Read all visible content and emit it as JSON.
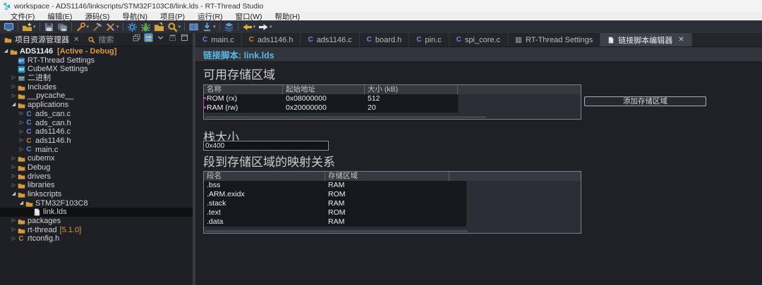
{
  "window": {
    "title": "workspace - ADS1146/linkscripts/STM32F103C8/link.lds - RT-Thread Studio",
    "menu_items": [
      "文件(F)",
      "编辑(E)",
      "源码(S)",
      "导航(N)",
      "项目(P)",
      "运行(R)",
      "窗口(W)",
      "帮助(H)"
    ]
  },
  "toolbar": {
    "groups": [
      [
        {
          "name": "monitor"
        }
      ],
      [
        {
          "name": "new-wizard",
          "dropdown": true
        }
      ],
      [
        {
          "name": "save"
        },
        {
          "name": "save-all"
        }
      ],
      [
        {
          "name": "build-wrench",
          "dropdown": true
        },
        {
          "name": "pickaxe"
        },
        {
          "name": "tools",
          "dropdown": true
        }
      ],
      [
        {
          "name": "gear"
        },
        {
          "name": "debug-bug"
        },
        {
          "name": "open-folder"
        },
        {
          "name": "search",
          "dropdown": true
        }
      ],
      [
        {
          "name": "book"
        },
        {
          "name": "download",
          "dropdown": true
        }
      ],
      [
        {
          "name": "layers"
        }
      ],
      [
        {
          "name": "back-arrow",
          "dropdown": true
        },
        {
          "name": "forward-arrow",
          "dropdown": true
        }
      ]
    ]
  },
  "explorer": {
    "tab_label": "项目资源管理器",
    "search_tab_label": "搜索",
    "tools": [
      "collapse-all",
      "link-editor",
      "chevron-down",
      "minimize",
      "maximize"
    ],
    "tree": [
      {
        "label": "ADS1146",
        "suffix": "[Active - Debug]",
        "icon": "folder",
        "depth": 0,
        "state": "expanded",
        "bold": true
      },
      {
        "label": "RT-Thread Settings",
        "icon": "rt-badge",
        "depth": 1,
        "state": "leaf"
      },
      {
        "label": "CubeMX Settings",
        "icon": "mx-badge",
        "depth": 1,
        "state": "leaf"
      },
      {
        "label": "二进制",
        "icon": "binary",
        "depth": 1,
        "state": "collapsed"
      },
      {
        "label": "Includes",
        "icon": "folder",
        "depth": 1,
        "state": "collapsed"
      },
      {
        "label": "__pycache__",
        "icon": "folder",
        "depth": 1,
        "state": "collapsed"
      },
      {
        "label": "applications",
        "icon": "folder",
        "depth": 1,
        "state": "expanded"
      },
      {
        "label": "ads_can.c",
        "icon": "c-blue",
        "depth": 2,
        "state": "collapsed"
      },
      {
        "label": "ads_can.h",
        "icon": "c-blue",
        "depth": 2,
        "state": "collapsed"
      },
      {
        "label": "ads1146.c",
        "icon": "c-blue",
        "depth": 2,
        "state": "collapsed"
      },
      {
        "label": "ads1146.h",
        "icon": "c-orange",
        "depth": 2,
        "state": "collapsed"
      },
      {
        "label": "main.c",
        "icon": "c-blue",
        "depth": 2,
        "state": "collapsed"
      },
      {
        "label": "cubemx",
        "icon": "folder",
        "depth": 1,
        "state": "collapsed"
      },
      {
        "label": "Debug",
        "icon": "folder",
        "depth": 1,
        "state": "collapsed"
      },
      {
        "label": "drivers",
        "icon": "folder",
        "depth": 1,
        "state": "collapsed"
      },
      {
        "label": "libraries",
        "icon": "folder",
        "depth": 1,
        "state": "collapsed"
      },
      {
        "label": "linkscripts",
        "icon": "folder",
        "depth": 1,
        "state": "expanded"
      },
      {
        "label": "STM32F103C8",
        "icon": "folder",
        "depth": 2,
        "state": "expanded"
      },
      {
        "label": "link.lds",
        "icon": "lds-file",
        "depth": 3,
        "state": "leaf",
        "selected": true
      },
      {
        "label": "packages",
        "icon": "folder",
        "depth": 1,
        "state": "collapsed"
      },
      {
        "label": "rt-thread",
        "suffix_plain": "[5.1.0]",
        "icon": "folder",
        "depth": 1,
        "state": "collapsed"
      },
      {
        "label": "rtconfig.h",
        "icon": "c-orange",
        "depth": 1,
        "state": "collapsed"
      }
    ]
  },
  "editor": {
    "tabs": [
      {
        "label": "main.c",
        "icon": "c-blue"
      },
      {
        "label": "ads1146.h",
        "icon": "c-orange"
      },
      {
        "label": "ads1146.c",
        "icon": "c-blue"
      },
      {
        "label": "board.h",
        "icon": "c-blue"
      },
      {
        "label": "pin.c",
        "icon": "c-blue"
      },
      {
        "label": "spi_core.c",
        "icon": "c-blue"
      },
      {
        "label": "RT-Thread Settings",
        "icon": "grid"
      },
      {
        "label": "链接脚本编辑器",
        "icon": "lds-file",
        "active": true,
        "close": true
      }
    ],
    "file_header": "链接脚本: link.lds",
    "memory": {
      "title": "可用存储区域",
      "headers": [
        "名称",
        "起始地址",
        "大小  (kB)"
      ],
      "rows": [
        [
          "ROM (rx)",
          "0x08000000",
          "512"
        ],
        [
          "RAM (rw)",
          "0x20000000",
          "20"
        ]
      ],
      "add_button": "添加存储区域"
    },
    "stack": {
      "title": "栈大小",
      "value": "0x400"
    },
    "mapping": {
      "title": "段到存储区域的映射关系",
      "headers": [
        "段名",
        "存储区域"
      ],
      "rows": [
        [
          ".bss",
          "RAM"
        ],
        [
          ".ARM.exidx",
          "ROM"
        ],
        [
          ".stack",
          "RAM"
        ],
        [
          ".text",
          "ROM"
        ],
        [
          ".data",
          "RAM"
        ]
      ]
    }
  },
  "colors": {
    "accent_cyan": "#5bb7e3",
    "suffix_orange": "#dd9a3b",
    "folder_amber": "#d59a3d",
    "c_blue": "#6d8bd9",
    "c_orange": "#c8872f",
    "row_marker_magenta": "#b13ab1"
  }
}
